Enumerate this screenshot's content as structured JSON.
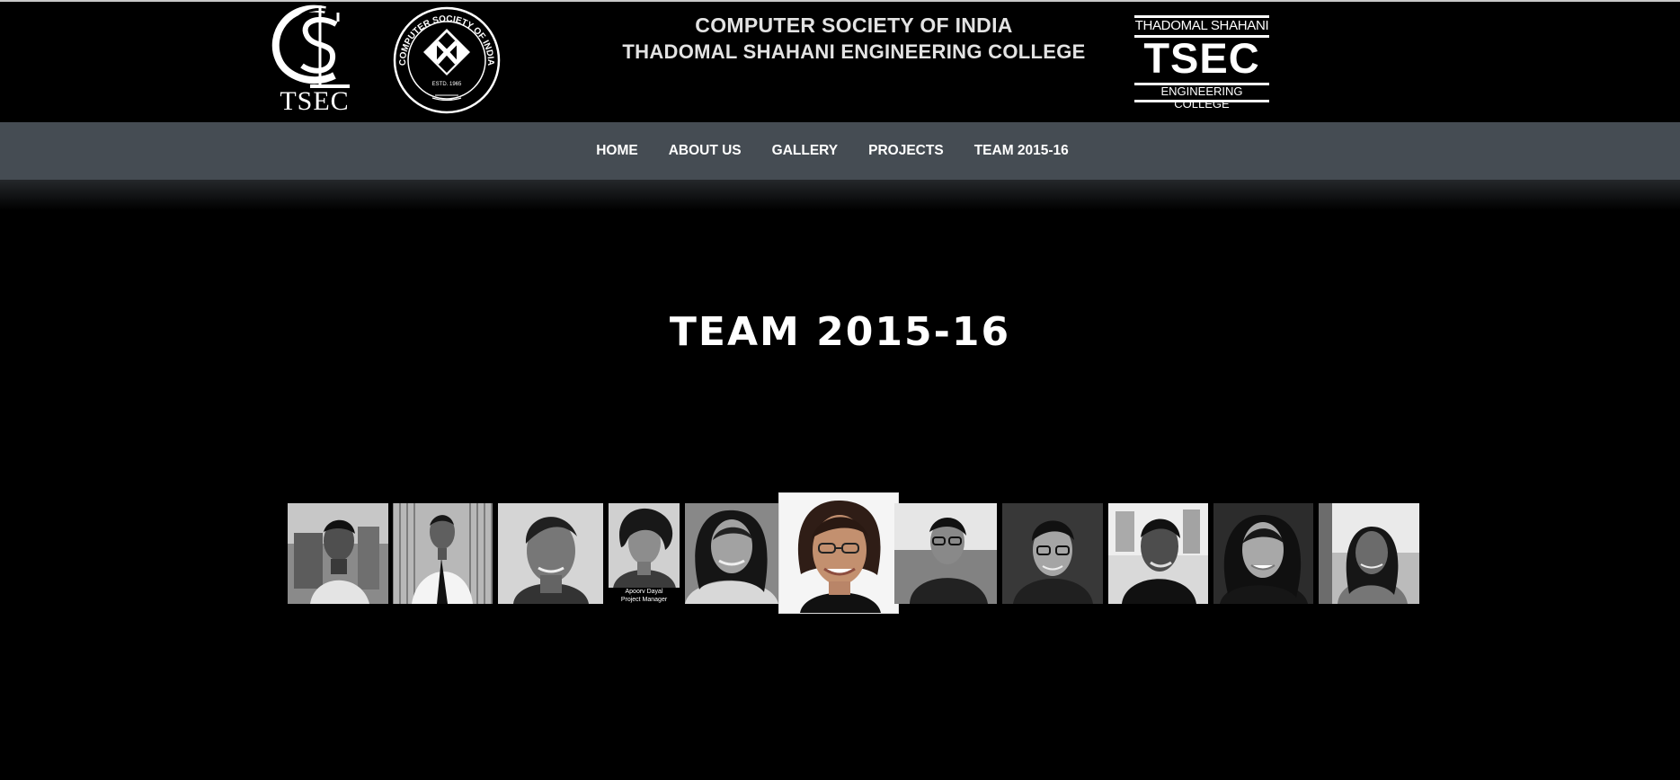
{
  "header": {
    "org_line": "COMPUTER SOCIETY OF INDIA",
    "college_line": "THADOMAL SHAHANI ENGINEERING COLLEGE",
    "left_logo_text": "TSEC",
    "seal_ring_text": "COMPUTER SOCIETY OF INDIA",
    "seal_estd": "ESTD. 1965",
    "badge_top": "THADOMAL SHAHANI",
    "badge_main": "TSEC",
    "badge_bottom": "ENGINEERING COLLEGE"
  },
  "nav": {
    "items": [
      {
        "label": "HOME"
      },
      {
        "label": "ABOUT US"
      },
      {
        "label": "GALLERY"
      },
      {
        "label": "PROJECTS"
      },
      {
        "label": "TEAM 2015-16"
      }
    ]
  },
  "main": {
    "title": "TEAM 2015-16"
  },
  "team": {
    "members": [
      {
        "photo": "team-member-photo-1"
      },
      {
        "photo": "team-member-photo-2"
      },
      {
        "photo": "team-member-photo-3"
      },
      {
        "photo": "team-member-photo-4",
        "caption_name": "Apoorv Dayal",
        "caption_role": "Project Manager"
      },
      {
        "photo": "team-member-photo-5"
      },
      {
        "photo": "team-member-photo-6",
        "state": "highlighted"
      },
      {
        "photo": "team-member-photo-7"
      },
      {
        "photo": "team-member-photo-8"
      },
      {
        "photo": "team-member-photo-9"
      },
      {
        "photo": "team-member-photo-10"
      },
      {
        "photo": "team-member-photo-11"
      }
    ]
  },
  "colors": {
    "page_background": "#000000",
    "navbar_background": "#454c53",
    "text": "#ffffff",
    "header_text": "#e3e3e3"
  }
}
